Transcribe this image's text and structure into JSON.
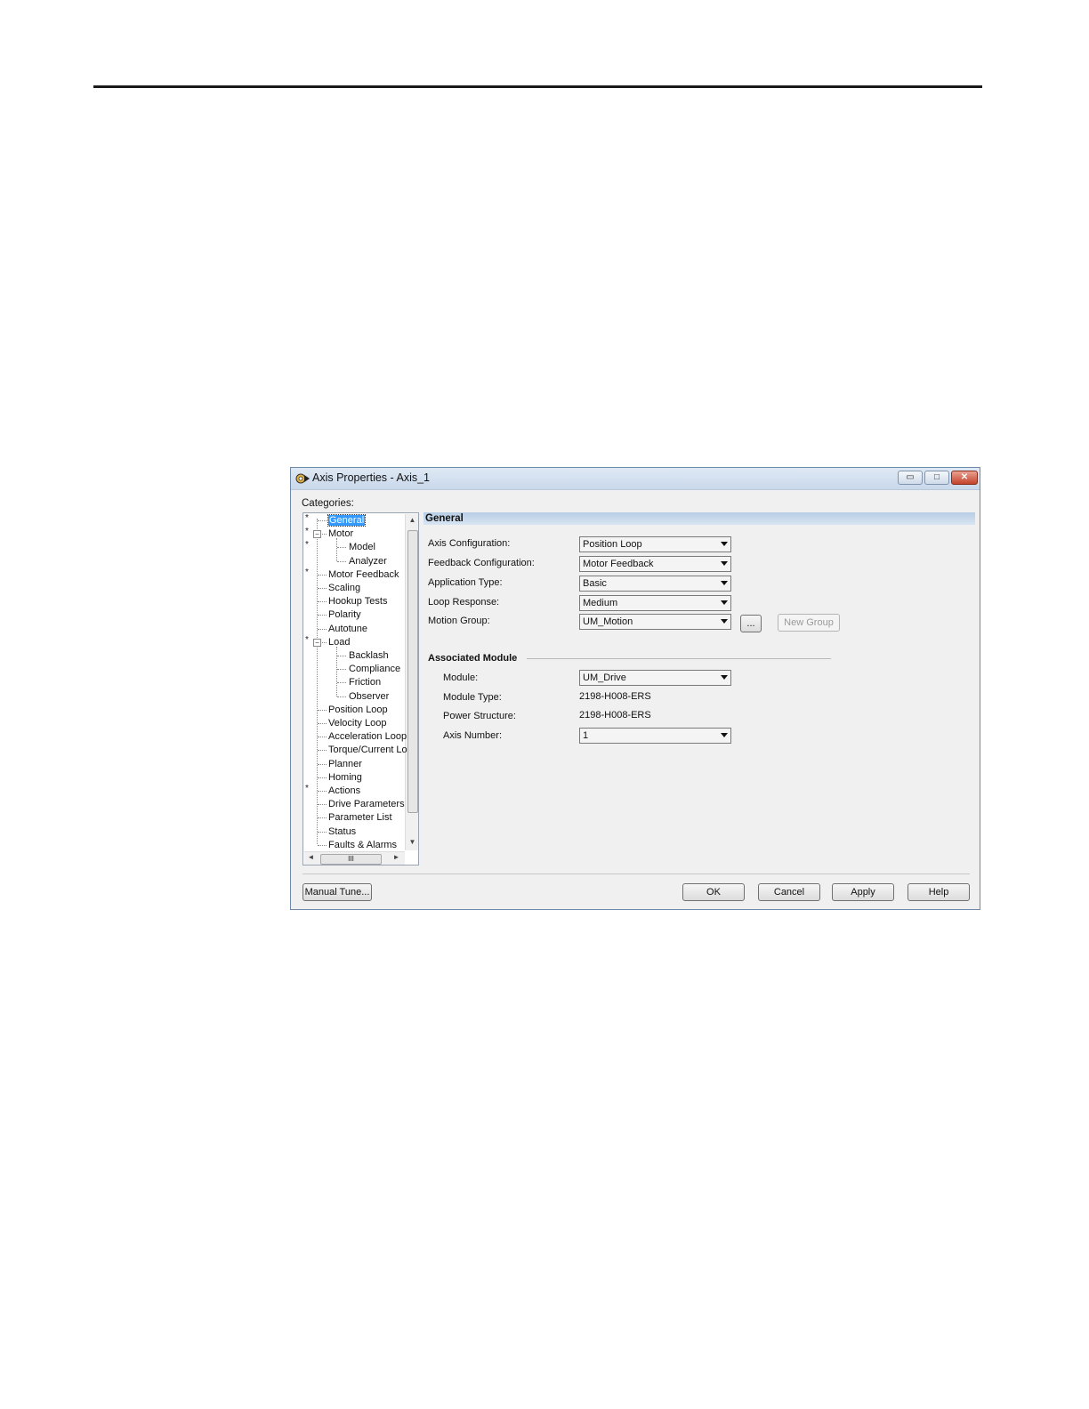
{
  "window": {
    "title": "Axis Properties - Axis_1",
    "controls": {
      "minimize": "▭",
      "maximize": "□",
      "close": "✕"
    }
  },
  "categories_label": "Categories:",
  "tree": {
    "items": [
      {
        "label": "General",
        "selected": true,
        "modified": true
      },
      {
        "label": "Motor",
        "expanded": true,
        "modified": true
      },
      {
        "label": "Model",
        "modified": true
      },
      {
        "label": "Analyzer"
      },
      {
        "label": "Motor Feedback",
        "modified": true
      },
      {
        "label": "Scaling"
      },
      {
        "label": "Hookup Tests"
      },
      {
        "label": "Polarity"
      },
      {
        "label": "Autotune"
      },
      {
        "label": "Load",
        "expanded": true,
        "modified": true
      },
      {
        "label": "Backlash"
      },
      {
        "label": "Compliance"
      },
      {
        "label": "Friction"
      },
      {
        "label": "Observer"
      },
      {
        "label": "Position Loop"
      },
      {
        "label": "Velocity Loop"
      },
      {
        "label": "Acceleration Loop"
      },
      {
        "label": "Torque/Current Lo"
      },
      {
        "label": "Planner"
      },
      {
        "label": "Homing"
      },
      {
        "label": "Actions",
        "modified": true
      },
      {
        "label": "Drive Parameters"
      },
      {
        "label": "Parameter List"
      },
      {
        "label": "Status"
      },
      {
        "label": "Faults & Alarms"
      }
    ],
    "modified_marker": "*",
    "hscroll_thumb": "III"
  },
  "general": {
    "header": "General",
    "axis_configuration": {
      "label": "Axis Configuration:",
      "value": "Position Loop"
    },
    "feedback_configuration": {
      "label": "Feedback Configuration:",
      "value": "Motor Feedback"
    },
    "application_type": {
      "label": "Application Type:",
      "value": "Basic"
    },
    "loop_response": {
      "label": "Loop Response:",
      "value": "Medium"
    },
    "motion_group": {
      "label": "Motion Group:",
      "value": "UM_Motion"
    },
    "browse_button": "...",
    "new_group_button": "New Group"
  },
  "associated_module": {
    "title": "Associated Module",
    "module": {
      "label": "Module:",
      "value": "UM_Drive"
    },
    "module_type": {
      "label": "Module Type:",
      "value": "2198-H008-ERS"
    },
    "power_structure": {
      "label": "Power Structure:",
      "value": "2198-H008-ERS"
    },
    "axis_number": {
      "label": "Axis Number:",
      "value": "1"
    }
  },
  "buttons": {
    "manual_tune": "Manual Tune...",
    "ok": "OK",
    "cancel": "Cancel",
    "apply": "Apply",
    "help": "Help"
  }
}
